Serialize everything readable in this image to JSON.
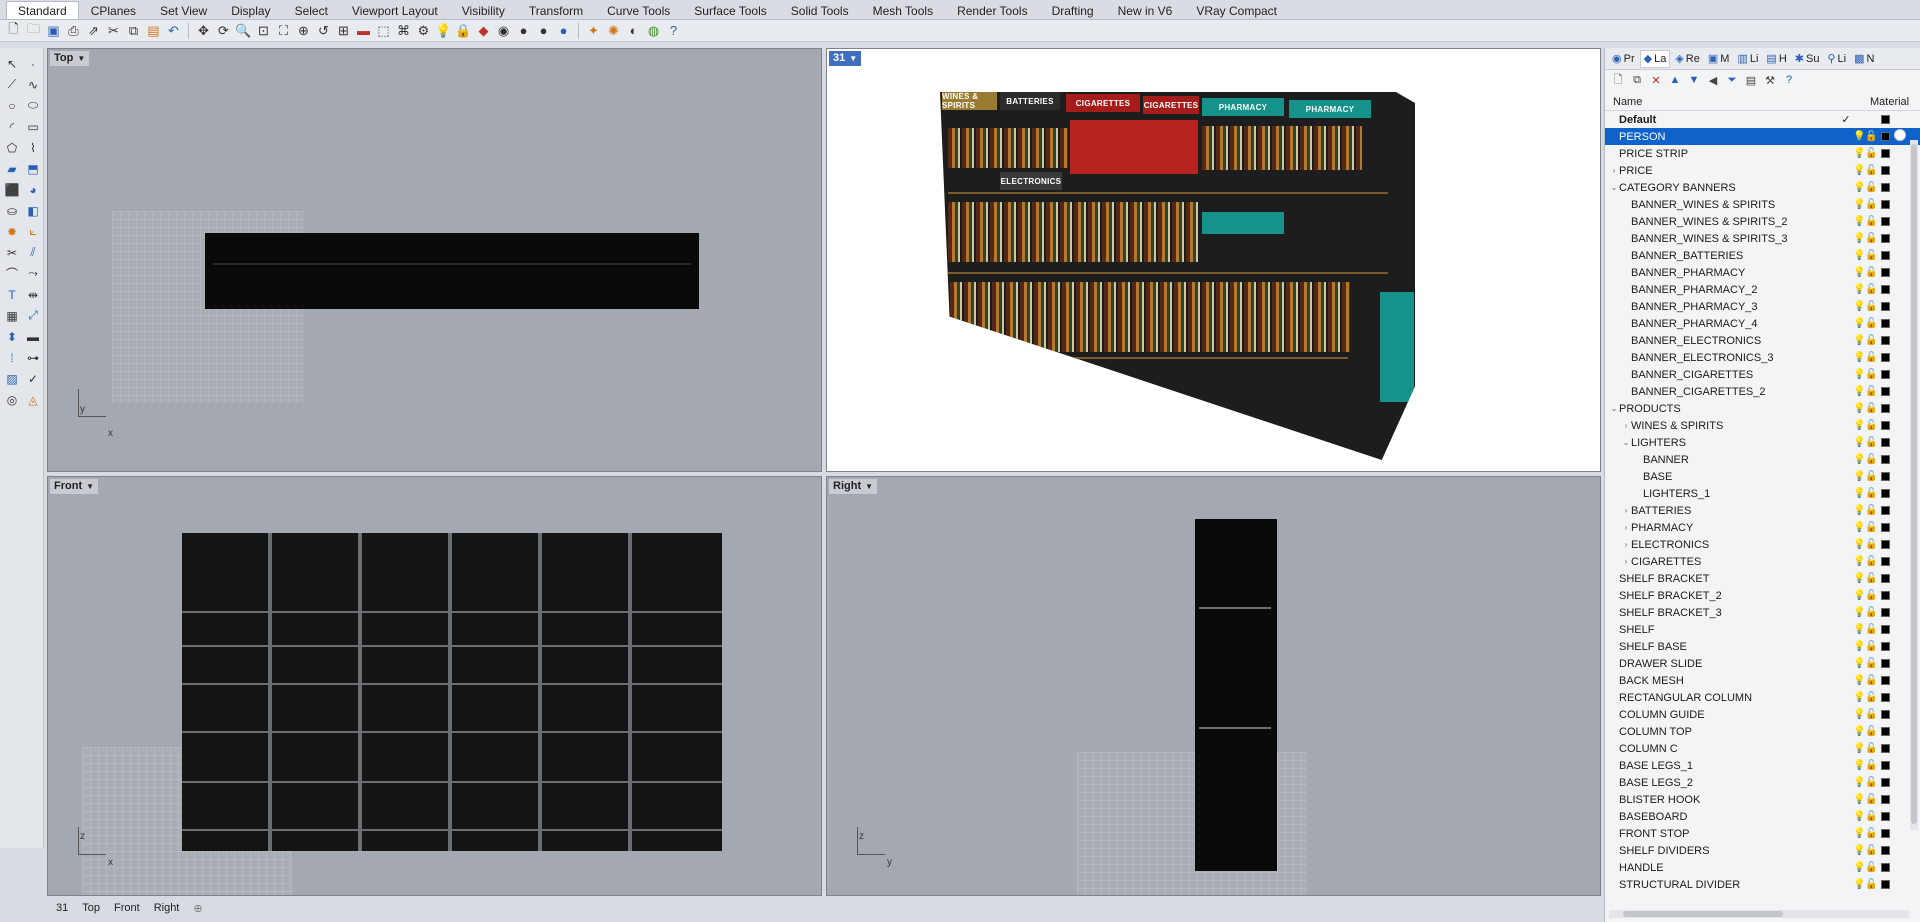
{
  "menu_tabs": [
    "Standard",
    "CPlanes",
    "Set View",
    "Display",
    "Select",
    "Viewport Layout",
    "Visibility",
    "Transform",
    "Curve Tools",
    "Surface Tools",
    "Solid Tools",
    "Mesh Tools",
    "Render Tools",
    "Drafting",
    "New in V6",
    "VRay Compact"
  ],
  "active_tab": "Standard",
  "viewports": {
    "top": {
      "label": "Top",
      "axis_x": "x",
      "axis_y": "y"
    },
    "perspective": {
      "label": "31"
    },
    "front": {
      "label": "Front",
      "axis_x": "x",
      "axis_y": "z"
    },
    "right": {
      "label": "Right",
      "axis_x": "y",
      "axis_y": "z"
    }
  },
  "banners": {
    "wines": "WINES & SPIRITS",
    "batteries": "BATTERIES",
    "cigarettes1": "CIGARETTES",
    "cigarettes2": "CIGARETTES",
    "pharmacy1": "PHARMACY",
    "pharmacy2": "PHARMACY",
    "electronics": "ELECTRONICS"
  },
  "panel": {
    "tabs": [
      "Pr",
      "La",
      "Re",
      "M",
      "Li",
      "H",
      "Su",
      "Li",
      "N"
    ],
    "column_name": "Name",
    "column_material": "Material",
    "layers": [
      {
        "name": "Default",
        "indent": 0,
        "expander": "",
        "bold": true,
        "current": true
      },
      {
        "name": "PERSON",
        "indent": 0,
        "expander": "",
        "selected": true
      },
      {
        "name": "PRICE STRIP",
        "indent": 0,
        "expander": ""
      },
      {
        "name": "PRICE",
        "indent": 0,
        "expander": ">"
      },
      {
        "name": "CATEGORY BANNERS",
        "indent": 0,
        "expander": "v"
      },
      {
        "name": "BANNER_WINES & SPIRITS",
        "indent": 1,
        "expander": ""
      },
      {
        "name": "BANNER_WINES & SPIRITS_2",
        "indent": 1,
        "expander": ""
      },
      {
        "name": "BANNER_WINES & SPIRITS_3",
        "indent": 1,
        "expander": ""
      },
      {
        "name": "BANNER_BATTERIES",
        "indent": 1,
        "expander": ""
      },
      {
        "name": "BANNER_PHARMACY",
        "indent": 1,
        "expander": ""
      },
      {
        "name": "BANNER_PHARMACY_2",
        "indent": 1,
        "expander": ""
      },
      {
        "name": "BANNER_PHARMACY_3",
        "indent": 1,
        "expander": ""
      },
      {
        "name": "BANNER_PHARMACY_4",
        "indent": 1,
        "expander": ""
      },
      {
        "name": "BANNER_ELECTRONICS",
        "indent": 1,
        "expander": ""
      },
      {
        "name": "BANNER_ELECTRONICS_3",
        "indent": 1,
        "expander": ""
      },
      {
        "name": "BANNER_CIGARETTES",
        "indent": 1,
        "expander": ""
      },
      {
        "name": "BANNER_CIGARETTES_2",
        "indent": 1,
        "expander": ""
      },
      {
        "name": "PRODUCTS",
        "indent": 0,
        "expander": "v"
      },
      {
        "name": "WINES & SPIRITS",
        "indent": 1,
        "expander": ">"
      },
      {
        "name": "LIGHTERS",
        "indent": 1,
        "expander": "v"
      },
      {
        "name": "BANNER",
        "indent": 2,
        "expander": ""
      },
      {
        "name": "BASE",
        "indent": 2,
        "expander": ""
      },
      {
        "name": "LIGHTERS_1",
        "indent": 2,
        "expander": ""
      },
      {
        "name": "BATTERIES",
        "indent": 1,
        "expander": ">"
      },
      {
        "name": "PHARMACY",
        "indent": 1,
        "expander": ">"
      },
      {
        "name": "ELECTRONICS",
        "indent": 1,
        "expander": ">"
      },
      {
        "name": "CIGARETTES",
        "indent": 1,
        "expander": ">"
      },
      {
        "name": "SHELF BRACKET",
        "indent": 0,
        "expander": ""
      },
      {
        "name": "SHELF BRACKET_2",
        "indent": 0,
        "expander": ""
      },
      {
        "name": "SHELF BRACKET_3",
        "indent": 0,
        "expander": ""
      },
      {
        "name": "SHELF",
        "indent": 0,
        "expander": ""
      },
      {
        "name": "SHELF BASE",
        "indent": 0,
        "expander": ""
      },
      {
        "name": "DRAWER SLIDE",
        "indent": 0,
        "expander": ""
      },
      {
        "name": "BACK MESH",
        "indent": 0,
        "expander": ""
      },
      {
        "name": "RECTANGULAR COLUMN",
        "indent": 0,
        "expander": ""
      },
      {
        "name": "COLUMN GUIDE",
        "indent": 0,
        "expander": ""
      },
      {
        "name": "COLUMN TOP",
        "indent": 0,
        "expander": ""
      },
      {
        "name": "COLUMN C",
        "indent": 0,
        "expander": ""
      },
      {
        "name": "BASE LEGS_1",
        "indent": 0,
        "expander": ""
      },
      {
        "name": "BASE LEGS_2",
        "indent": 0,
        "expander": ""
      },
      {
        "name": "BLISTER HOOK",
        "indent": 0,
        "expander": ""
      },
      {
        "name": "BASEBOARD",
        "indent": 0,
        "expander": ""
      },
      {
        "name": "FRONT STOP",
        "indent": 0,
        "expander": ""
      },
      {
        "name": "SHELF DIVIDERS",
        "indent": 0,
        "expander": ""
      },
      {
        "name": "HANDLE",
        "indent": 0,
        "expander": ""
      },
      {
        "name": "STRUCTURAL DIVIDER",
        "indent": 0,
        "expander": ""
      }
    ]
  },
  "viewport_tabs": [
    "31",
    "Top",
    "Front",
    "Right"
  ],
  "colors": {
    "accent": "#0e62c9",
    "viewport_bg": "#a4a9b1",
    "pharmacy": "#15928a",
    "cigarettes": "#b8231f"
  }
}
